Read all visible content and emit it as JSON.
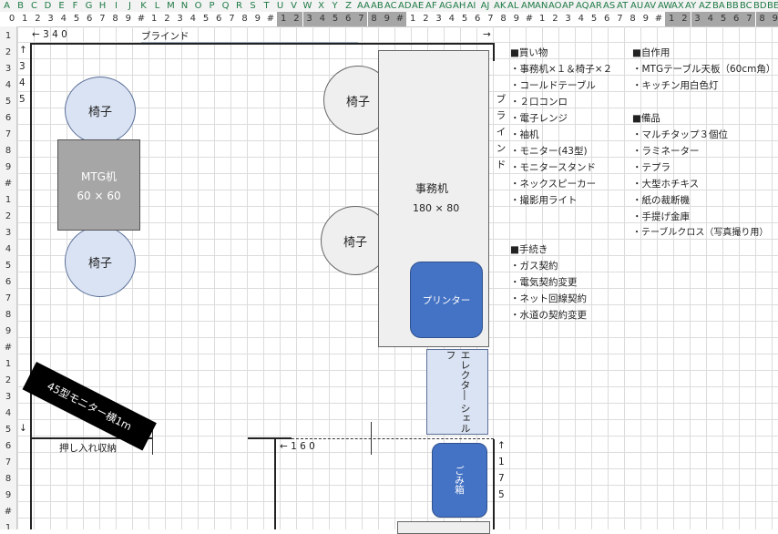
{
  "column_letters": [
    "A",
    "B",
    "C",
    "D",
    "E",
    "F",
    "G",
    "H",
    "I",
    "J",
    "K",
    "L",
    "M",
    "N",
    "O",
    "P",
    "Q",
    "R",
    "S",
    "T",
    "U",
    "V",
    "W",
    "X",
    "Y",
    "Z",
    "AA",
    "AB",
    "AC",
    "AD",
    "AE",
    "AF",
    "AG",
    "AH",
    "AI",
    "AJ",
    "AK",
    "AL",
    "AM",
    "AN",
    "AO",
    "AP",
    "AQ",
    "AR",
    "AS",
    "AT",
    "AU",
    "AV",
    "AW",
    "AX",
    "AY",
    "AZ",
    "BA",
    "BB",
    "BC",
    "BD",
    "BE"
  ],
  "number_row": [
    "0",
    "1",
    "2",
    "3",
    "4",
    "5",
    "6",
    "7",
    "8",
    "9",
    "#",
    "1",
    "2",
    "3",
    "4",
    "5",
    "6",
    "7",
    "8",
    "9",
    "#",
    "1",
    "2",
    "3",
    "4",
    "5",
    "6",
    "7",
    "8",
    "9",
    "#",
    "1",
    "2",
    "3",
    "4",
    "5",
    "6",
    "7",
    "8",
    "9",
    "#",
    "1",
    "2",
    "3",
    "4",
    "5",
    "6",
    "7",
    "8",
    "9",
    "#",
    "1",
    "2",
    "3",
    "4",
    "5",
    "6",
    "7",
    "8",
    "9",
    "#"
  ],
  "row_numbers": [
    "1",
    "2",
    "3",
    "4",
    "5",
    "6",
    "7",
    "8",
    "9",
    "#",
    "1",
    "2",
    "3",
    "4",
    "5",
    "6",
    "7",
    "8",
    "9",
    "#",
    "1",
    "2",
    "3",
    "4",
    "5",
    "6",
    "7",
    "8",
    "9",
    "#",
    "1"
  ],
  "row1": {
    "dim_left": "← 3 4 0",
    "blind": "ブラインド",
    "arrow_right": "→"
  },
  "left_dim": {
    "up": "↑",
    "digits": [
      "3",
      "4",
      "5",
      "5"
    ],
    "down": "↓"
  },
  "furniture": {
    "chair": "椅子",
    "mtg_desk": "MTG机",
    "mtg_size": "60 × 60",
    "office_desk": "事務机",
    "office_size": "180 × 80",
    "printer": "プリンター",
    "monitor": "45型モニター横1m",
    "shelf": "エレクタ― シェルフ",
    "trash": "ごみ箱",
    "blind_vertical": [
      "ブ",
      "ラ",
      "イ",
      "ン",
      "ド"
    ]
  },
  "closet": "押し入れ収納",
  "bottom_dim": "← 1 6 0",
  "right_dim": {
    "up": "↑",
    "digits": [
      "1",
      "7",
      "5"
    ]
  },
  "list_buy": {
    "heading": "■買い物",
    "items": [
      "・事務机×１＆椅子×２",
      "・コールドテーブル",
      "・２口コンロ",
      "・電子レンジ",
      "・袖机",
      "・モニター(43型)",
      "・モニタースタンド",
      "・ネックスピーカー",
      "・撮影用ライト"
    ]
  },
  "list_diy": {
    "heading": "■自作用",
    "items": [
      "・MTGテーブル天板（60cm角）",
      "・キッチン用白色灯"
    ]
  },
  "list_equipment": {
    "heading": "■備品",
    "items": [
      "・マルチタップ３個位",
      "・ラミネーター",
      "・テプラ",
      "・大型ホチキス",
      "・紙の裁断機",
      "・手提げ金庫",
      "・テーブルクロス（写真撮り用）"
    ]
  },
  "list_procedures": {
    "heading": "■手続き",
    "items": [
      "・ガス契約",
      "・電気契約変更",
      "・ネット回線契約",
      "・水道の契約変更"
    ]
  },
  "colors": {
    "chair_blue": "#dae3f3",
    "printer": "#4472c4",
    "mtg": "#a6a6a6",
    "monitor": "#000000",
    "shelf": "#dae3f3"
  }
}
